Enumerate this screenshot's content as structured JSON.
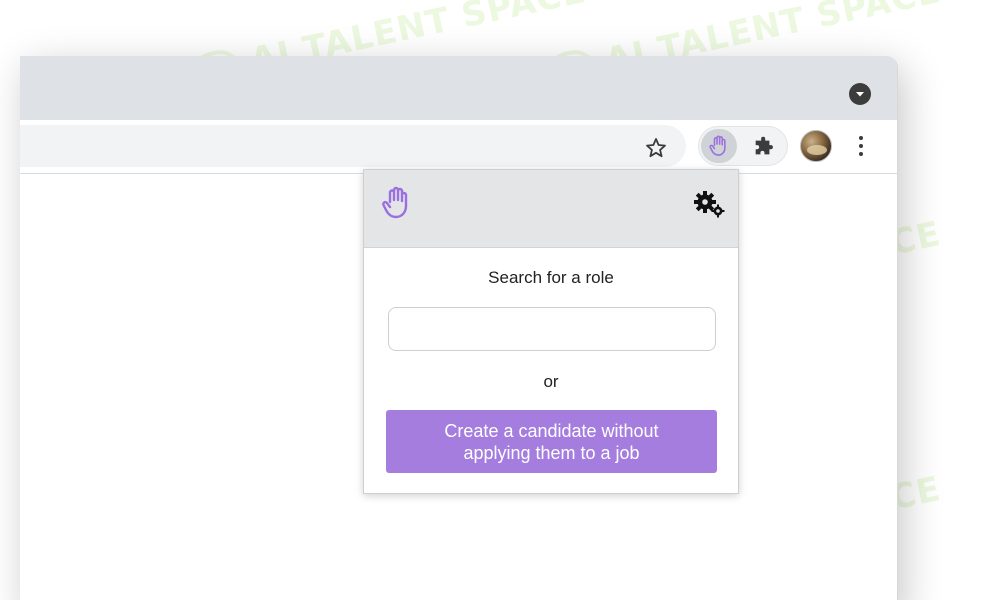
{
  "colors": {
    "accent": "#a47ddf",
    "tabstrip": "#dee1e6",
    "popup_header": "#e4e5e7",
    "watermark": "#aae16e"
  },
  "watermark": {
    "text": "AI TALENT SPACE"
  },
  "toolbar": {
    "bookmark_icon": "star-icon",
    "extension_icon": "raised-hand-icon",
    "extensions_menu_icon": "puzzle-icon",
    "profile_icon": "avatar",
    "menu_icon": "vertical-dots-icon",
    "tab_search_icon": "chevron-down-icon"
  },
  "popup": {
    "logo_icon": "raised-hand-icon",
    "settings_icon": "gears-icon",
    "search_label": "Search for a role",
    "search_value": "",
    "or_text": "or",
    "create_button_label": "Create a candidate without applying them to a job"
  }
}
